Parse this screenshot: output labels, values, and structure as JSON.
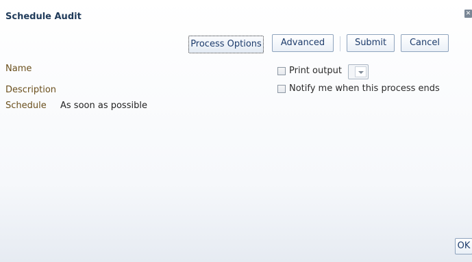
{
  "dialog": {
    "title": "Schedule Audit",
    "close_glyph": "x"
  },
  "toolbar": {
    "process_options": "Process Options",
    "advanced": "Advanced",
    "submit": "Submit",
    "cancel": "Cancel"
  },
  "form": {
    "name_label": "Name",
    "description_label": "Description",
    "schedule_label": "Schedule",
    "schedule_value": "As soon as possible",
    "print_output_label": "Print output",
    "print_output_checked": false,
    "notify_label": "Notify me when this process ends",
    "notify_checked": false
  },
  "footer": {
    "ok": "OK"
  }
}
